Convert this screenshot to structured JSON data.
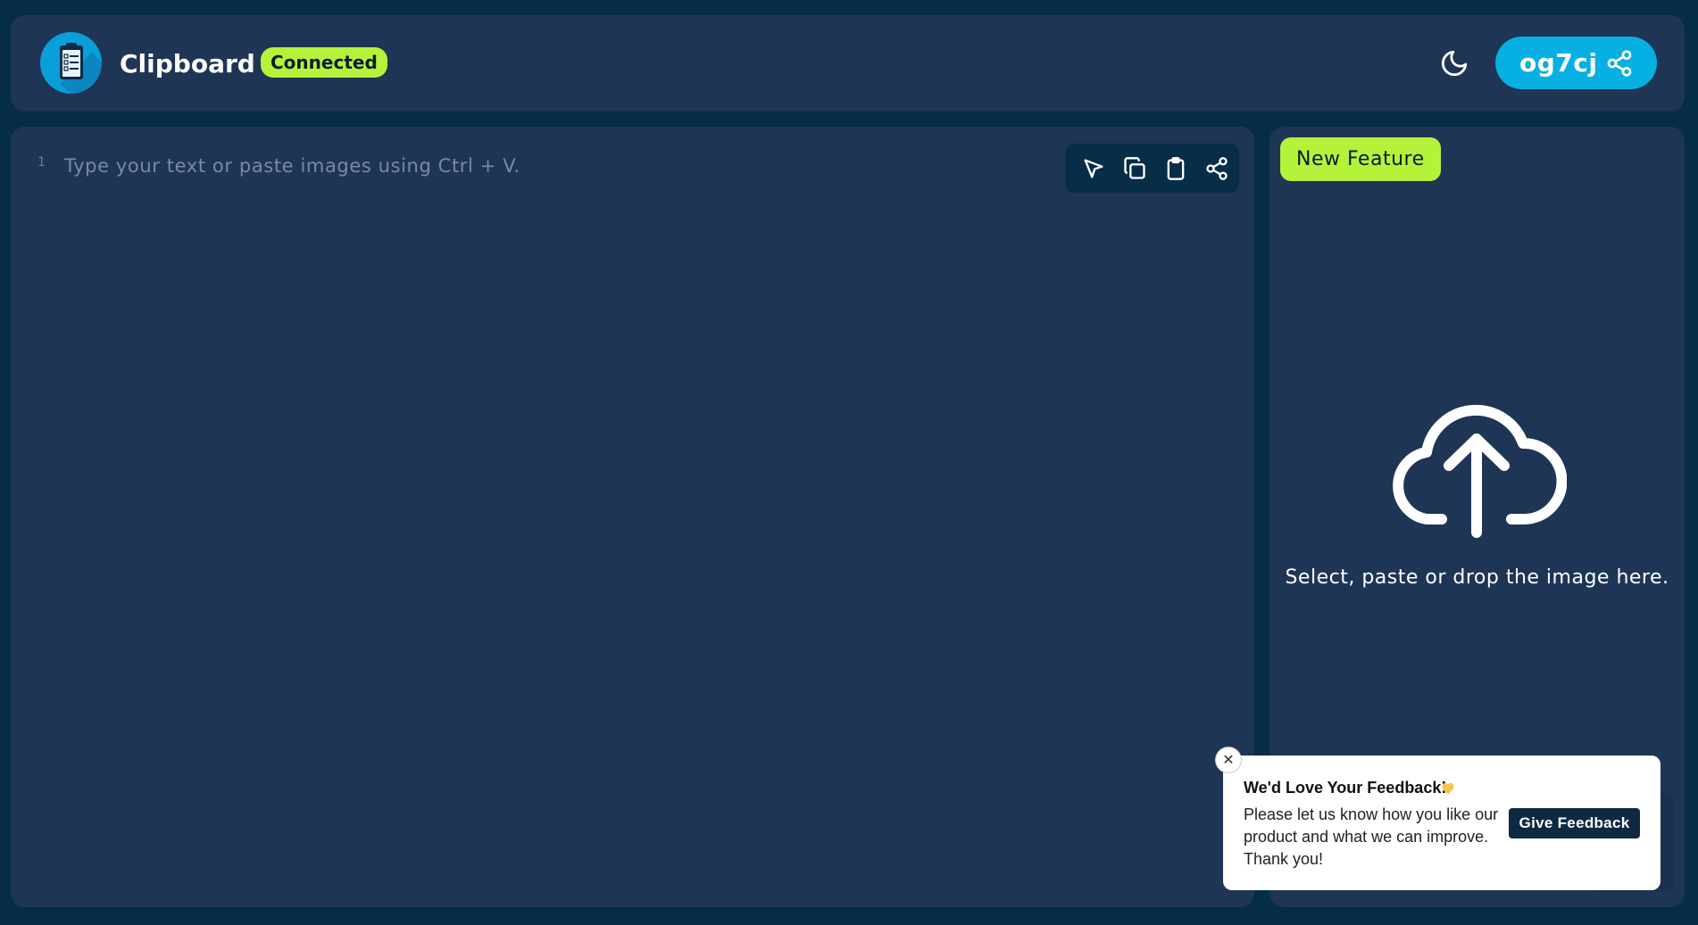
{
  "header": {
    "app_title": "Clipboard",
    "status": "Connected",
    "room_code": "og7cj"
  },
  "editor": {
    "line_number": "1",
    "placeholder": "Type your text or paste images using Ctrl + V.",
    "value": ""
  },
  "image_panel": {
    "badge": "New Feature",
    "upload_text": "Select, paste or drop the image here."
  },
  "feedback": {
    "close": "✕",
    "title": "We'd Love Your Feedback!",
    "body": "Please let us know how you like our product and what we can improve. Thank you!",
    "button": "Give Feedback"
  },
  "icons": {
    "logo": "clipboard-checklist-icon",
    "theme": "moon-icon",
    "room_share": "share-icon",
    "toolbar": [
      "cursor-select-icon",
      "copy-icon",
      "clipboard-paste-icon",
      "share-icon"
    ],
    "upload": "cloud-upload-icon",
    "heart": "heart-icon"
  },
  "colors": {
    "background": "#052e46",
    "panel": "#1e3556",
    "accent_green": "#b5f23a",
    "accent_blue": "#06b0e2"
  }
}
